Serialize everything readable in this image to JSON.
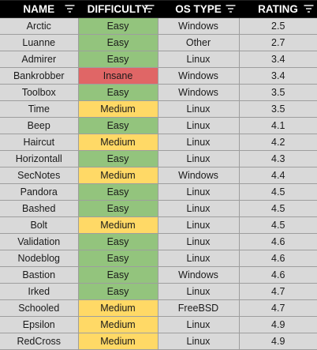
{
  "colors": {
    "header_bg": "#000000",
    "header_text": "#ffffff",
    "cell_bg": "#d9d9d9",
    "easy": "#93c47d",
    "medium": "#ffd966",
    "insane": "#e06666"
  },
  "header": {
    "name": "NAME",
    "difficulty": "DIFFICULTY",
    "os_type": "OS TYPE",
    "rating": "RATING",
    "filter_icon": "filter-icon"
  },
  "rows": [
    {
      "name": "Arctic",
      "difficulty": "Easy",
      "os": "Windows",
      "rating": "2.5"
    },
    {
      "name": "Luanne",
      "difficulty": "Easy",
      "os": "Other",
      "rating": "2.7"
    },
    {
      "name": "Admirer",
      "difficulty": "Easy",
      "os": "Linux",
      "rating": "3.4"
    },
    {
      "name": "Bankrobber",
      "difficulty": "Insane",
      "os": "Windows",
      "rating": "3.4"
    },
    {
      "name": "Toolbox",
      "difficulty": "Easy",
      "os": "Windows",
      "rating": "3.5"
    },
    {
      "name": "Time",
      "difficulty": "Medium",
      "os": "Linux",
      "rating": "3.5"
    },
    {
      "name": "Beep",
      "difficulty": "Easy",
      "os": "Linux",
      "rating": "4.1"
    },
    {
      "name": "Haircut",
      "difficulty": "Medium",
      "os": "Linux",
      "rating": "4.2"
    },
    {
      "name": "Horizontall",
      "difficulty": "Easy",
      "os": "Linux",
      "rating": "4.3"
    },
    {
      "name": "SecNotes",
      "difficulty": "Medium",
      "os": "Windows",
      "rating": "4.4"
    },
    {
      "name": "Pandora",
      "difficulty": "Easy",
      "os": "Linux",
      "rating": "4.5"
    },
    {
      "name": "Bashed",
      "difficulty": "Easy",
      "os": "Linux",
      "rating": "4.5"
    },
    {
      "name": "Bolt",
      "difficulty": "Medium",
      "os": "Linux",
      "rating": "4.5"
    },
    {
      "name": "Validation",
      "difficulty": "Easy",
      "os": "Linux",
      "rating": "4.6"
    },
    {
      "name": "Nodeblog",
      "difficulty": "Easy",
      "os": "Linux",
      "rating": "4.6"
    },
    {
      "name": "Bastion",
      "difficulty": "Easy",
      "os": "Windows",
      "rating": "4.6"
    },
    {
      "name": "Irked",
      "difficulty": "Easy",
      "os": "Linux",
      "rating": "4.7"
    },
    {
      "name": "Schooled",
      "difficulty": "Medium",
      "os": "FreeBSD",
      "rating": "4.7"
    },
    {
      "name": "Epsilon",
      "difficulty": "Medium",
      "os": "Linux",
      "rating": "4.9"
    },
    {
      "name": "RedCross",
      "difficulty": "Medium",
      "os": "Linux",
      "rating": "4.9"
    }
  ]
}
